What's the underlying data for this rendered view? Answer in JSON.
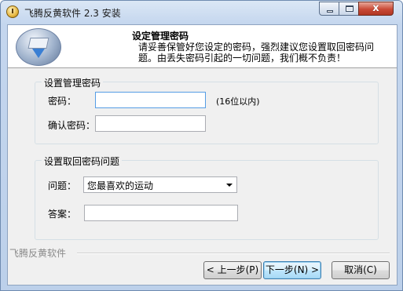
{
  "window": {
    "title": "飞腾反黄软件 2.3 安装",
    "close_glyph": "x"
  },
  "header": {
    "title": "设定管理密码",
    "description": "请妥善保管好您设定的密码，强烈建议您设置取回密码问题。由丢失密码引起的一切问题，我们概不负责！"
  },
  "password_group": {
    "legend": "设置管理密码",
    "password_label": "密码：",
    "password_value": "",
    "password_hint": "(16位以内)",
    "confirm_label": "确认密码：",
    "confirm_value": ""
  },
  "recovery_group": {
    "legend": "设置取回密码问题",
    "question_label": "问题：",
    "question_selected": "您最喜欢的运动",
    "answer_label": "答案：",
    "answer_value": ""
  },
  "footer": {
    "brand": "飞腾反黄软件",
    "back_button": "< 上一步(P)",
    "next_button": "下一步(N) >",
    "cancel_button": "取消(C)"
  },
  "icons": {
    "app": "installer-app-icon",
    "logo": "disk-download-icon",
    "minimize": "minimize-icon",
    "maximize": "maximize-icon",
    "close": "close-icon",
    "dropdown": "chevron-down-icon"
  }
}
